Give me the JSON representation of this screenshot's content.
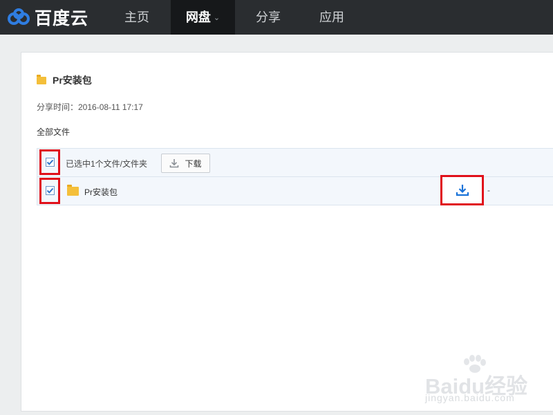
{
  "header": {
    "logo_text": "百度云",
    "nav": [
      {
        "label": "主页"
      },
      {
        "label": "网盘"
      },
      {
        "label": "分享"
      },
      {
        "label": "应用"
      }
    ]
  },
  "share": {
    "title": "Pr安装包",
    "share_time": "分享时间：2016-08-11 17:17",
    "all_files": "全部文件"
  },
  "file_list": {
    "selected_text": "已选中1个文件/文件夹",
    "download_label": "下载",
    "rows": [
      {
        "name": "Pr安装包",
        "size": "-",
        "checked": true
      }
    ]
  },
  "watermark": {
    "brand": "Baidu经验",
    "url": "jingyan.baidu.com"
  },
  "colors": {
    "nav_bg": "#2a2d30",
    "accent": "#1a73d9",
    "highlight": "#e0101a",
    "folder": "#f4bf3a"
  }
}
